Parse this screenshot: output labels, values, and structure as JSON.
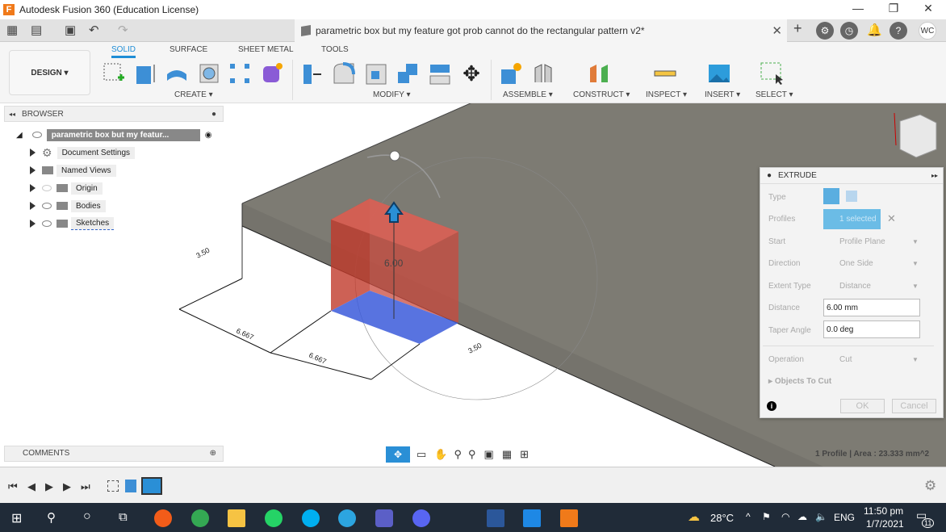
{
  "app": {
    "title": "Autodesk Fusion 360 (Education License)",
    "logo": "F"
  },
  "window_controls": {
    "minimize": "—",
    "restore": "❐",
    "close": "✕"
  },
  "document_tab": {
    "title": "parametric box but my feature got prob cannot do the rectangular pattern v2*",
    "close": "✕"
  },
  "user": {
    "initials": "WC"
  },
  "toolbar": {
    "workspace": "DESIGN ▾",
    "tabs": [
      {
        "label": "SOLID",
        "active": true
      },
      {
        "label": "SURFACE"
      },
      {
        "label": "SHEET METAL"
      },
      {
        "label": "TOOLS"
      }
    ],
    "groups": [
      "CREATE ▾",
      "MODIFY ▾",
      "ASSEMBLE ▾",
      "CONSTRUCT ▾",
      "INSPECT ▾",
      "INSERT ▾",
      "SELECT ▾"
    ]
  },
  "browser": {
    "title": "BROWSER",
    "root": "parametric box but my featur...",
    "items": [
      {
        "label": "Document Settings",
        "icon": "gear-icon"
      },
      {
        "label": "Named Views",
        "icon": "folder-icon"
      },
      {
        "label": "Origin",
        "icon": "folder-icon"
      },
      {
        "label": "Bodies",
        "icon": "folder-icon"
      },
      {
        "label": "Sketches",
        "icon": "folder-icon"
      }
    ]
  },
  "comments": {
    "title": "COMMENTS"
  },
  "viewport": {
    "dims": {
      "d1": "3.50",
      "d2": "6.667",
      "d3": "6.667",
      "d4": "3.50",
      "height": "6.00"
    },
    "colors": {
      "body": "#c0392b",
      "profile": "#3b5bdb",
      "slab": "#7d7b73"
    }
  },
  "extrude": {
    "title": "EXTRUDE",
    "type_label": "Type",
    "profiles_label": "Profiles",
    "profiles_value": "1 selected",
    "start_label": "Start",
    "start_value": "Profile Plane",
    "direction_label": "Direction",
    "direction_value": "One Side",
    "extent_label": "Extent Type",
    "extent_value": "Distance",
    "distance_label": "Distance",
    "distance_value": "6.00 mm",
    "taper_label": "Taper Angle",
    "taper_value": "0.0 deg",
    "operation_label": "Operation",
    "operation_value": "Cut",
    "objects_label": "Objects To Cut",
    "ok": "OK",
    "cancel": "Cancel"
  },
  "status": {
    "text": "1 Profile | Area : 23.333 mm^2"
  },
  "timeline": {
    "first": "⏮",
    "prev": "◀",
    "play": "▶",
    "next": "▶",
    "last": "⏭"
  },
  "taskbar": {
    "weather": "28°C",
    "lang": "ENG",
    "time": "11:50 pm",
    "date": "1/7/2021",
    "notifications": "11"
  }
}
